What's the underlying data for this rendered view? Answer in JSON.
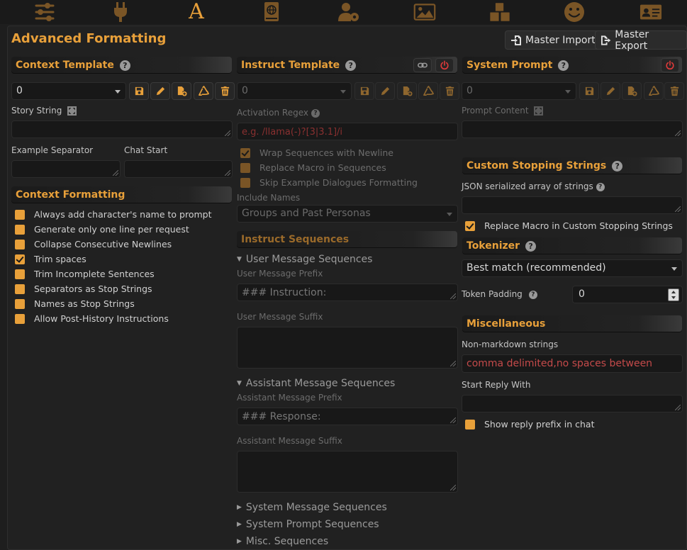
{
  "colors": {
    "accent": "#e8a03a",
    "danger": "#e03a3a",
    "placeholder": "#8a3030"
  },
  "nav": {
    "icons": [
      "sliders-icon",
      "plug-icon",
      "font-a-icon",
      "book-atlas-icon",
      "user-gear-icon",
      "image-landscape-icon",
      "cubes-icon",
      "smiley-icon",
      "id-card-icon"
    ],
    "font_glyph": "A"
  },
  "page": {
    "title": "Advanced Formatting",
    "master_import": "Master Import",
    "master_export": "Master Export"
  },
  "context": {
    "header": "Context Template",
    "selected": "0",
    "story_string_label": "Story String",
    "example_separator_label": "Example Separator",
    "chat_start_label": "Chat Start"
  },
  "context_formatting": {
    "header": "Context Formatting",
    "options": [
      {
        "label": "Always add character's name to prompt",
        "checked": false
      },
      {
        "label": "Generate only one line per request",
        "checked": false
      },
      {
        "label": "Collapse Consecutive Newlines",
        "checked": false
      },
      {
        "label": "Trim spaces",
        "checked": true
      },
      {
        "label": "Trim Incomplete Sentences",
        "checked": false
      },
      {
        "label": "Separators as Stop Strings",
        "checked": false
      },
      {
        "label": "Names as Stop Strings",
        "checked": false
      },
      {
        "label": "Allow Post-History Instructions",
        "checked": false
      }
    ]
  },
  "instruct": {
    "header": "Instruct Template",
    "selected": "0",
    "activation_regex_label": "Activation Regex",
    "activation_regex_placeholder": "e.g. /llama(-)?[3|3.1]/i",
    "wrap_sequences": "Wrap Sequences with Newline",
    "replace_macro": "Replace Macro in Sequences",
    "skip_example": "Skip Example Dialogues Formatting",
    "include_names_label": "Include Names",
    "include_names_value": "Groups and Past Personas",
    "sequences_header": "Instruct Sequences",
    "user_sequences": "User Message Sequences",
    "user_prefix_label": "User Message Prefix",
    "user_prefix_value": "### Instruction:",
    "user_suffix_label": "User Message Suffix",
    "assistant_sequences": "Assistant Message Sequences",
    "assistant_prefix_label": "Assistant Message Prefix",
    "assistant_prefix_value": "### Response:",
    "assistant_suffix_label": "Assistant Message Suffix",
    "system_sequences": "System Message Sequences",
    "system_prompt_sequences": "System Prompt Sequences",
    "misc_sequences": "Misc. Sequences"
  },
  "system_prompt": {
    "header": "System Prompt",
    "selected": "0",
    "prompt_content_label": "Prompt Content"
  },
  "stopping": {
    "header": "Custom Stopping Strings",
    "json_label": "JSON serialized array of strings",
    "replace_macro": "Replace Macro in Custom Stopping Strings"
  },
  "tokenizer": {
    "header": "Tokenizer",
    "selected": "Best match (recommended)",
    "token_padding_label": "Token Padding",
    "token_padding_value": "0"
  },
  "misc": {
    "header": "Miscellaneous",
    "non_markdown_label": "Non-markdown strings",
    "non_markdown_placeholder": "comma delimited,no spaces between",
    "start_reply_label": "Start Reply With",
    "show_reply_prefix": "Show reply prefix in chat"
  }
}
